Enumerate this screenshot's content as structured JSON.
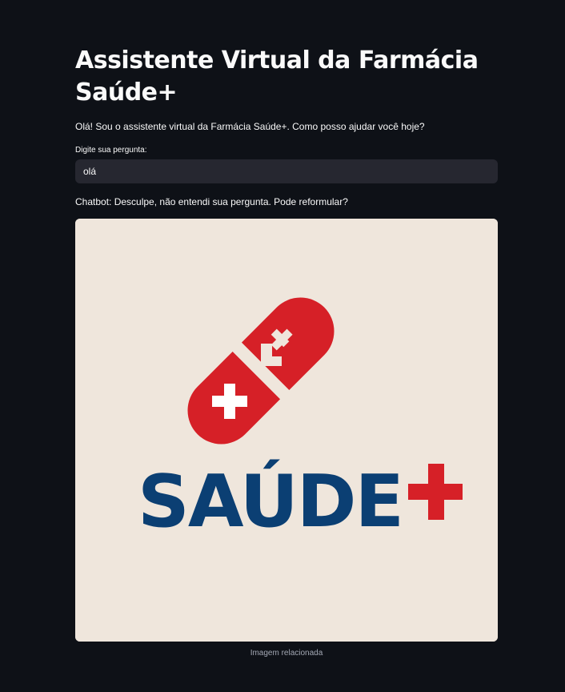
{
  "header": {
    "title": "Assistente Virtual da Farmácia Saúde+"
  },
  "intro": {
    "text": "Olá! Sou o assistente virtual da Farmácia Saúde+. Como posso ajudar você hoje?"
  },
  "question_input": {
    "label": "Digite sua pergunta:",
    "value": "olá"
  },
  "chatbot": {
    "response": "Chatbot: Desculpe, não entendi sua pergunta. Pode reformular?"
  },
  "image": {
    "logo_text": "SAÚDE",
    "caption": "Imagem relacionada"
  },
  "colors": {
    "background": "#0e1117",
    "input_bg": "#262730",
    "logo_red": "#d62027",
    "logo_blue": "#0b3f73",
    "image_bg": "#efe6dc"
  }
}
